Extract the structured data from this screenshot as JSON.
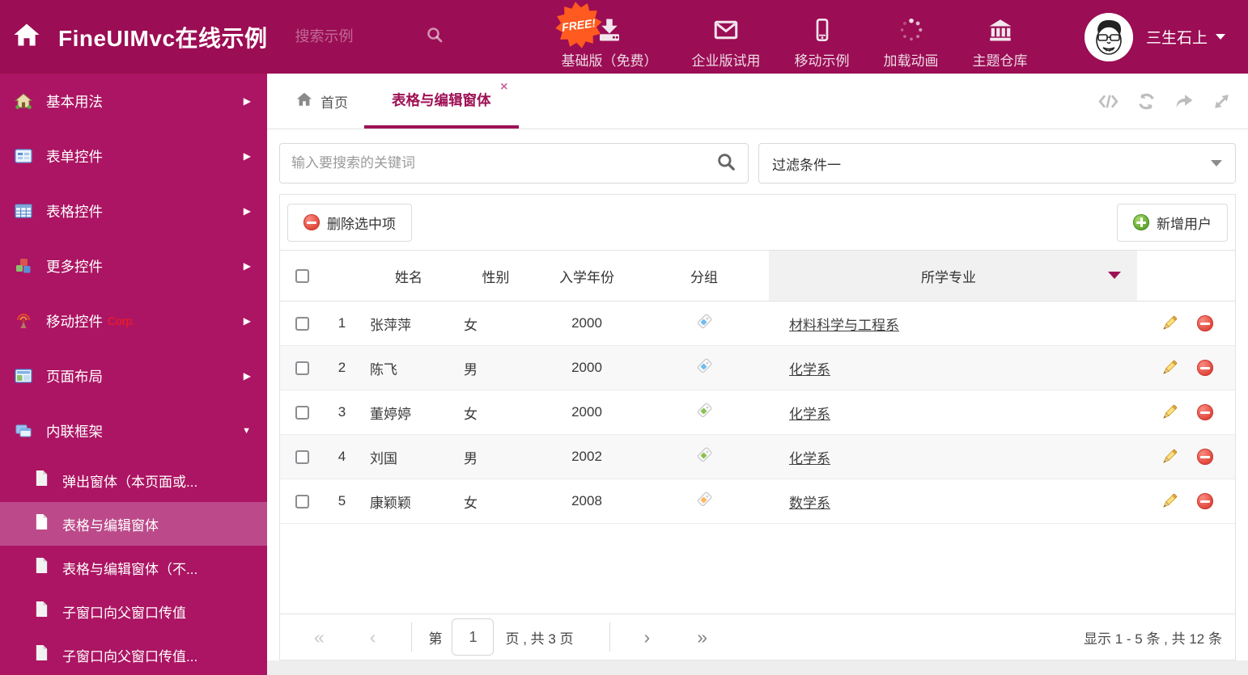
{
  "colors": {
    "header_bg": "#9B0D54",
    "sidebar_bg": "#AC1563",
    "sidebar_selected_bg": "#BC4A8A",
    "accent": "#9E1155",
    "free_badge_bg": "#FF5A1F",
    "tag_blue": "#6FBDEF",
    "tag_green": "#8CC152",
    "tag_orange": "#FFB561"
  },
  "header": {
    "title": "FineUIMvc在线示例",
    "search_placeholder": "搜索示例",
    "free_badge": "FREE!",
    "nav": [
      {
        "label": "基础版（免费）",
        "icon": "download-icon"
      },
      {
        "label": "企业版试用",
        "icon": "envelope-icon"
      },
      {
        "label": "移动示例",
        "icon": "mobile-icon"
      },
      {
        "label": "加载动画",
        "icon": "spinner-icon"
      },
      {
        "label": "主题仓库",
        "icon": "bank-icon"
      }
    ],
    "user": {
      "name": "三生石上"
    }
  },
  "sidebar": {
    "items": [
      {
        "label": "基本用法",
        "icon": "home-icon"
      },
      {
        "label": "表单控件",
        "icon": "form-icon"
      },
      {
        "label": "表格控件",
        "icon": "table-icon"
      },
      {
        "label": "更多控件",
        "icon": "cubes-icon"
      },
      {
        "label": "移动控件",
        "badge": "Corp.",
        "icon": "antenna-icon"
      },
      {
        "label": "页面布局",
        "icon": "layout-icon"
      },
      {
        "label": "内联框架",
        "icon": "frames-icon"
      }
    ],
    "subitems": [
      {
        "label": "弹出窗体（本页面或..."
      },
      {
        "label": "表格与编辑窗体"
      },
      {
        "label": "表格与编辑窗体（不..."
      },
      {
        "label": "子窗口向父窗口传值"
      },
      {
        "label": "子窗口向父窗口传值..."
      }
    ]
  },
  "tabs": {
    "home": "首页",
    "active": "表格与编辑窗体",
    "tools": [
      "code-icon",
      "refresh-icon",
      "share-icon",
      "expand-icon"
    ]
  },
  "filters": {
    "search_placeholder": "输入要搜索的关键词",
    "dropdown_value": "过滤条件一"
  },
  "grid": {
    "delete_selected_label": "删除选中项",
    "add_user_label": "新增用户",
    "columns": {
      "name": "姓名",
      "gender": "性别",
      "year": "入学年份",
      "group": "分组",
      "major": "所学专业"
    },
    "rows": [
      {
        "num": "1",
        "name": "张萍萍",
        "gender": "女",
        "year": "2000",
        "tag_style": "color:#6FBDEF",
        "major": "材料科学与工程系"
      },
      {
        "num": "2",
        "name": "陈飞",
        "gender": "男",
        "year": "2000",
        "tag_style": "color:#6FBDEF",
        "major": "化学系"
      },
      {
        "num": "3",
        "name": "董婷婷",
        "gender": "女",
        "year": "2000",
        "tag_style": "color:#8CC152",
        "major": "化学系"
      },
      {
        "num": "4",
        "name": "刘国",
        "gender": "男",
        "year": "2002",
        "tag_style": "color:#8CC152",
        "major": "化学系"
      },
      {
        "num": "5",
        "name": "康颖颖",
        "gender": "女",
        "year": "2008",
        "tag_style": "color:#FFB561",
        "major": "数学系"
      }
    ],
    "pager": {
      "prefix": "第",
      "page": "1",
      "suffix": "页 , 共 3 页",
      "summary": "显示 1 - 5 条 , 共 12 条"
    }
  }
}
